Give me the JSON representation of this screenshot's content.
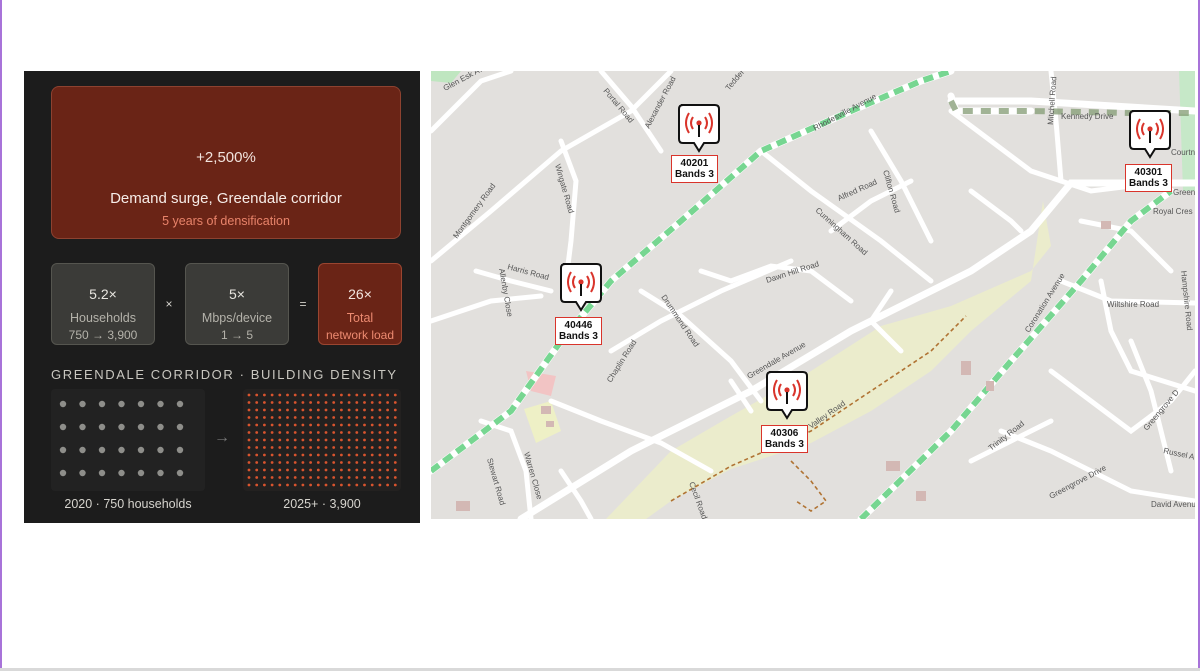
{
  "hero": {
    "change": "+2,500%",
    "title": "Demand surge, Greendale corridor",
    "subtitle": "5 years of densification"
  },
  "metrics": [
    {
      "value": "5.2×",
      "label": "Households",
      "detail": "750 → 3,900"
    },
    {
      "value": "5×",
      "label": "Mbps/device",
      "detail": "1 → 5"
    },
    {
      "value": "26×",
      "label": "Total",
      "detail": "network load"
    }
  ],
  "operators": [
    "×",
    "="
  ],
  "density": {
    "title": "GREENDALE CORRIDOR · BUILDING DENSITY",
    "before_caption": "2020 · 750 households",
    "after_caption": "2025+ · 3,900",
    "arrow": "→"
  },
  "colors": {
    "panel_bg": "#1c1c1c",
    "accent_bg": "#6a2416",
    "accent_text": "#e8836a",
    "dot_before": "#8e8e8a",
    "dot_after": "#d9542e",
    "site_marker": "#d9342b",
    "corridor_green": "#5fcf7e"
  },
  "map": {
    "road_labels": [
      "Glen Esk Av",
      "Portal Road",
      "Alexander Road",
      "Tedder",
      "Rhodesville Avenue",
      "Kennedy Drive",
      "Mitchell Road",
      "Wingate Road",
      "Montgomery Road",
      "Alfred Road",
      "Clifton Road",
      "Cunningham Road",
      "Harris Road",
      "Allenby Close",
      "Dawn Hill Road",
      "Drummond Road",
      "Chaplin Road",
      "Greendale Avenue",
      "Coronation Avenue",
      "Wiltshire Road",
      "Hampshire Road",
      "Royal Cres",
      "Valley Road",
      "Trinity Road",
      "Greengrove Drive",
      "Stewart Road",
      "Warren Close",
      "Cecil Road",
      "Russel A",
      "David Avenue",
      "Greengrove D",
      "Greendale",
      "Courtn"
    ],
    "sites": [
      {
        "id": "40201",
        "bands": "Bands 3"
      },
      {
        "id": "40446",
        "bands": "Bands 3"
      },
      {
        "id": "40306",
        "bands": "Bands 3"
      },
      {
        "id": "40301",
        "bands": "Bands 3"
      }
    ],
    "icon": "cell-tower-icon"
  }
}
